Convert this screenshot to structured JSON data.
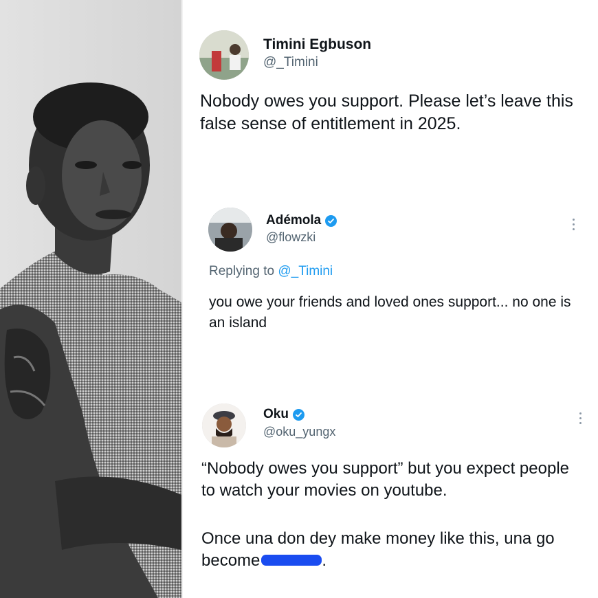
{
  "left_photo": {
    "alt_name": "portrait-photo"
  },
  "tweets": [
    {
      "name": "Timini Egbuson",
      "handle": "@_Timini",
      "verified": false,
      "text": "Nobody owes you support. Please let’s leave this false sense of entitlement in 2025."
    },
    {
      "name": "Adémola",
      "handle": "@flowzki",
      "verified": true,
      "replying_prefix": "Replying to",
      "replying_to": "@_Timini",
      "text": "you owe your friends and loved ones support... no one is an island"
    },
    {
      "name": "Oku",
      "handle": "@oku_yungx",
      "verified": true,
      "text_p1": "“Nobody owes you support” but you expect people to watch your movies on youtube.",
      "text_p2_start": "Once una don dey make money like this, una go become",
      "text_p2_end": "."
    }
  ],
  "colors": {
    "verified": "#1d9bf0",
    "handle": "#536471",
    "text": "#0f1419",
    "scribble": "#1a4cf0"
  },
  "icons": {
    "verified": "verified-badge-icon",
    "more": "more-options-icon"
  }
}
